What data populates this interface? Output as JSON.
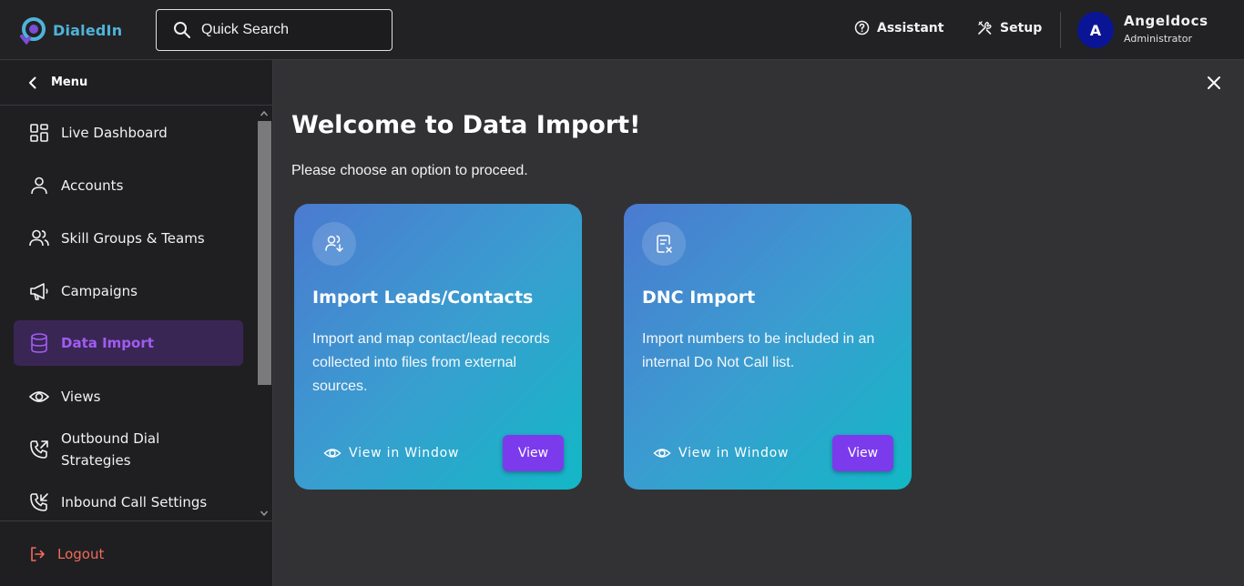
{
  "app": {
    "name": "DialedIn",
    "brand_color": "#4fb3d9",
    "accent_color": "#7c3aed"
  },
  "header": {
    "search_placeholder": "Quick Search",
    "assistant_label": "Assistant",
    "setup_label": "Setup",
    "user": {
      "initial": "A",
      "name": "Angeldocs",
      "role": "Administrator"
    }
  },
  "sidebar": {
    "menu_label": "Menu",
    "items": [
      {
        "label": "Live Dashboard",
        "icon": "dashboard-icon"
      },
      {
        "label": "Accounts",
        "icon": "user-icon"
      },
      {
        "label": "Skill Groups & Teams",
        "icon": "users-icon"
      },
      {
        "label": "Campaigns",
        "icon": "megaphone-icon"
      },
      {
        "label": "Data Import",
        "icon": "database-icon",
        "active": true
      },
      {
        "label": "Views",
        "icon": "eye-icon"
      },
      {
        "label": "Outbound Dial Strategies",
        "icon": "phone-outgoing-icon"
      },
      {
        "label": "Inbound Call Settings",
        "icon": "phone-incoming-icon"
      }
    ],
    "logout_label": "Logout"
  },
  "main": {
    "title": "Welcome to Data Import!",
    "subtitle": "Please choose an option to proceed.",
    "cards": [
      {
        "title": "Import Leads/Contacts",
        "description": "Import and map contact/lead records collected into files from external sources.",
        "window_label": "View in Window",
        "view_label": "View",
        "icon": "user-import-icon"
      },
      {
        "title": "DNC Import",
        "description": "Import numbers to be included in an internal Do Not Call list.",
        "window_label": "View in Window",
        "view_label": "View",
        "icon": "document-x-icon"
      }
    ]
  }
}
